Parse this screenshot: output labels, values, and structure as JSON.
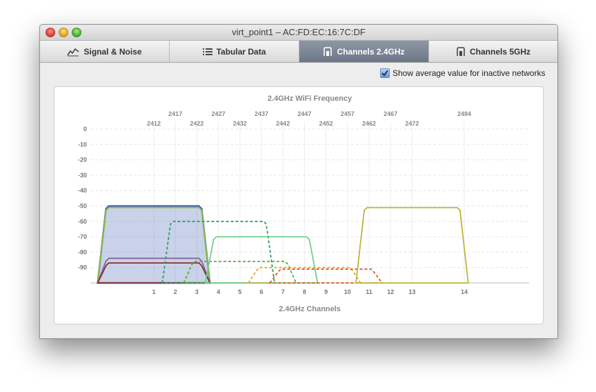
{
  "window": {
    "title": "virt_point1 – AC:FD:EC:16:7C:DF"
  },
  "tabs": [
    {
      "label": "Signal & Noise",
      "icon": "signal-graph-icon",
      "active": false
    },
    {
      "label": "Tabular Data",
      "icon": "list-icon",
      "active": false
    },
    {
      "label": "Channels 2.4GHz",
      "icon": "channel-icon",
      "active": true
    },
    {
      "label": "Channels 5GHz",
      "icon": "channel-icon",
      "active": false
    }
  ],
  "options": {
    "show_average_label": "Show average value for inactive networks",
    "show_average_checked": true
  },
  "chart_data": {
    "type": "area",
    "title": "2.4GHz WiFi Frequency",
    "xlabel": "2.4GHz Channels",
    "channels": [
      "1",
      "2",
      "3",
      "4",
      "5",
      "6",
      "7",
      "8",
      "9",
      "10",
      "11",
      "12",
      "13",
      "14"
    ],
    "frequencies_top": [
      "2412",
      "2422",
      "2432",
      "2442",
      "2452",
      "2462",
      "2472"
    ],
    "frequencies_upper": [
      "2417",
      "2427",
      "2437",
      "2447",
      "2457",
      "2467",
      "2484"
    ],
    "y_ticks": [
      "0",
      "-10",
      "-20",
      "-30",
      "-40",
      "-50",
      "-60",
      "-70",
      "-80",
      "-90"
    ],
    "ylim": [
      -100,
      0
    ],
    "grid": true,
    "series": [
      {
        "channel": 1,
        "signal": -50,
        "color": "#4a6aa8",
        "style": "solid",
        "filled": true
      },
      {
        "channel": 1,
        "signal": -51,
        "color": "#8dbf3a",
        "style": "solid",
        "filled": false
      },
      {
        "channel": 1,
        "signal": -84,
        "color": "#7d6aa0",
        "style": "solid",
        "filled": false
      },
      {
        "channel": 1,
        "signal": -87,
        "color": "#8c2b2b",
        "style": "solid",
        "filled": false
      },
      {
        "channel": 4,
        "signal": -60,
        "color": "#2e9a62",
        "style": "dashed",
        "filled": false
      },
      {
        "channel": 5,
        "signal": -86,
        "color": "#4fae3c",
        "style": "dashed",
        "filled": false
      },
      {
        "channel": 6,
        "signal": -70,
        "color": "#6fd08a",
        "style": "solid",
        "filled": false
      },
      {
        "channel": 8,
        "signal": -90,
        "color": "#f0a030",
        "style": "dashed",
        "filled": false
      },
      {
        "channel": 9,
        "signal": -91,
        "color": "#e05a20",
        "style": "dashed",
        "filled": false
      },
      {
        "channel": 13,
        "signal": -51,
        "color": "#b8b83a",
        "style": "solid",
        "filled": false
      }
    ]
  }
}
